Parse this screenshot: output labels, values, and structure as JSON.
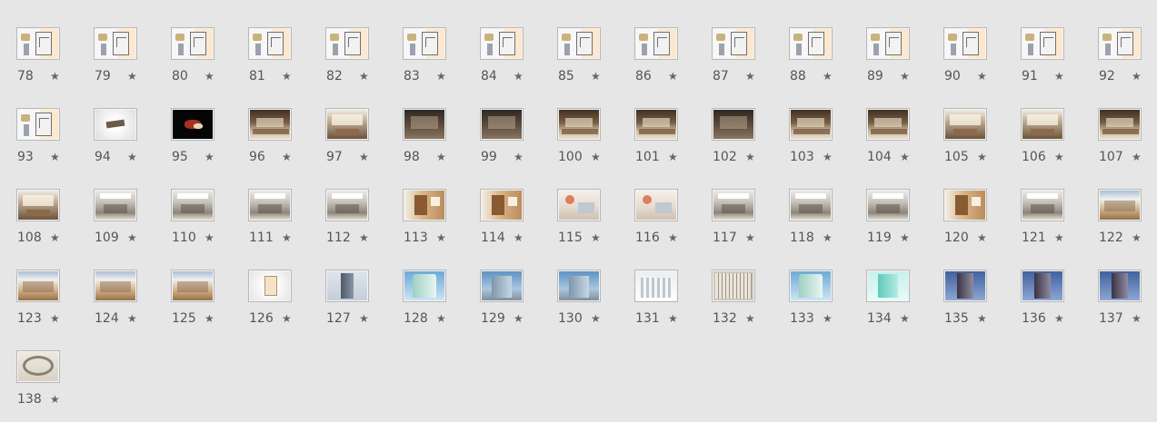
{
  "slides": [
    {
      "num": "78",
      "type": "plan"
    },
    {
      "num": "79",
      "type": "plan"
    },
    {
      "num": "80",
      "type": "plan"
    },
    {
      "num": "81",
      "type": "plan"
    },
    {
      "num": "82",
      "type": "plan"
    },
    {
      "num": "83",
      "type": "plan"
    },
    {
      "num": "84",
      "type": "plan"
    },
    {
      "num": "85",
      "type": "plan"
    },
    {
      "num": "86",
      "type": "plan"
    },
    {
      "num": "87",
      "type": "plan"
    },
    {
      "num": "88",
      "type": "plan"
    },
    {
      "num": "89",
      "type": "plan"
    },
    {
      "num": "90",
      "type": "plan"
    },
    {
      "num": "91",
      "type": "plan"
    },
    {
      "num": "92",
      "type": "plan"
    },
    {
      "num": "93",
      "type": "plan"
    },
    {
      "num": "94",
      "type": "white"
    },
    {
      "num": "95",
      "type": "black"
    },
    {
      "num": "96",
      "type": "room"
    },
    {
      "num": "97",
      "type": "room2"
    },
    {
      "num": "98",
      "type": "dark"
    },
    {
      "num": "99",
      "type": "dark"
    },
    {
      "num": "100",
      "type": "room"
    },
    {
      "num": "101",
      "type": "room"
    },
    {
      "num": "102",
      "type": "dark"
    },
    {
      "num": "103",
      "type": "room"
    },
    {
      "num": "104",
      "type": "room"
    },
    {
      "num": "105",
      "type": "room2"
    },
    {
      "num": "106",
      "type": "room2"
    },
    {
      "num": "107",
      "type": "room"
    },
    {
      "num": "108",
      "type": "room2"
    },
    {
      "num": "109",
      "type": "office"
    },
    {
      "num": "110",
      "type": "office"
    },
    {
      "num": "111",
      "type": "office"
    },
    {
      "num": "112",
      "type": "office"
    },
    {
      "num": "113",
      "type": "wood"
    },
    {
      "num": "114",
      "type": "wood"
    },
    {
      "num": "115",
      "type": "bath"
    },
    {
      "num": "116",
      "type": "bath"
    },
    {
      "num": "117",
      "type": "office"
    },
    {
      "num": "118",
      "type": "office"
    },
    {
      "num": "119",
      "type": "office"
    },
    {
      "num": "120",
      "type": "wood"
    },
    {
      "num": "121",
      "type": "office"
    },
    {
      "num": "122",
      "type": "hall"
    },
    {
      "num": "123",
      "type": "hall"
    },
    {
      "num": "124",
      "type": "hall"
    },
    {
      "num": "125",
      "type": "hall"
    },
    {
      "num": "126",
      "type": "card"
    },
    {
      "num": "127",
      "type": "tower"
    },
    {
      "num": "128",
      "type": "tower2"
    },
    {
      "num": "129",
      "type": "tower3"
    },
    {
      "num": "130",
      "type": "tower3"
    },
    {
      "num": "131",
      "type": "white-bld"
    },
    {
      "num": "132",
      "type": "grid-bld"
    },
    {
      "num": "133",
      "type": "tower2"
    },
    {
      "num": "134",
      "type": "cyan"
    },
    {
      "num": "135",
      "type": "blue-bld"
    },
    {
      "num": "136",
      "type": "blue-bld"
    },
    {
      "num": "137",
      "type": "blue-bld"
    },
    {
      "num": "138",
      "type": "aerial"
    }
  ],
  "star_glyph": "★",
  "icons": {
    "star": "star-icon"
  }
}
